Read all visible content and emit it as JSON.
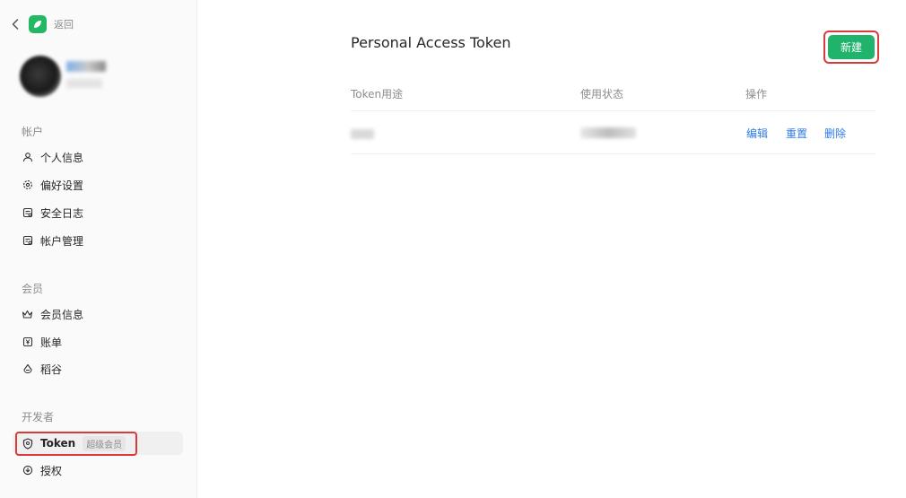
{
  "sidebar": {
    "back_label": "返回",
    "sections": [
      {
        "title": "帐户",
        "items": [
          {
            "label": "个人信息",
            "icon": "user-icon"
          },
          {
            "label": "偏好设置",
            "icon": "gear-icon"
          },
          {
            "label": "安全日志",
            "icon": "log-icon"
          },
          {
            "label": "帐户管理",
            "icon": "account-manage-icon"
          }
        ]
      },
      {
        "title": "会员",
        "items": [
          {
            "label": "会员信息",
            "icon": "crown-icon"
          },
          {
            "label": "账单",
            "icon": "bill-icon"
          },
          {
            "label": "稻谷",
            "icon": "grain-icon"
          }
        ]
      },
      {
        "title": "开发者",
        "items": [
          {
            "label": "Token",
            "icon": "shield-icon",
            "badge": "超级会员",
            "active": true
          },
          {
            "label": "授权",
            "icon": "authorize-icon"
          }
        ]
      }
    ]
  },
  "main": {
    "title": "Personal Access Token",
    "new_button": "新建",
    "table": {
      "headers": [
        "Token用途",
        "使用状态",
        "操作"
      ],
      "actions": [
        "编辑",
        "重置",
        "删除"
      ]
    }
  },
  "colors": {
    "accent_green": "#1fb36b",
    "link_blue": "#2f7be6",
    "highlight_red": "#d93a3a"
  }
}
